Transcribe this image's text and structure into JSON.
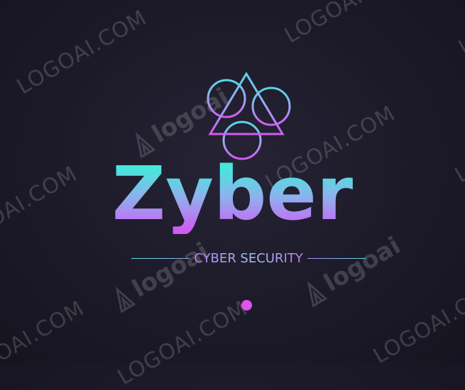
{
  "brand": {
    "name": "Zyber",
    "tagline": "CYBER SECURITY"
  },
  "watermark": {
    "site": "LOGOAI.COM",
    "logo": "logoai"
  },
  "colors": {
    "background": "#1c1a28",
    "cyan": "#48e6dc",
    "blue": "#8fb0ee",
    "magenta": "#d05cf4",
    "dot": "#df52f0"
  },
  "icons": {
    "emblem": "triangle-with-three-circles",
    "page_dot": "dot-icon"
  }
}
